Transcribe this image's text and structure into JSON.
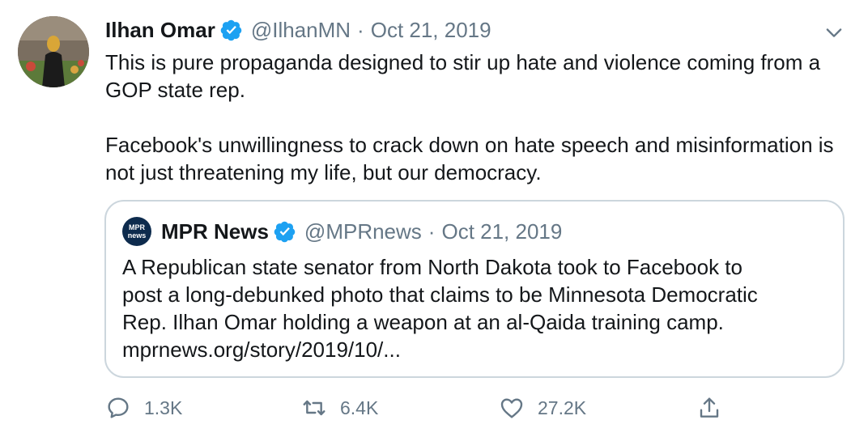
{
  "tweet": {
    "author_name": "Ilhan Omar",
    "handle": "@IlhanMN",
    "separator": "·",
    "date": "Oct 21, 2019",
    "text_paragraph_1": "This is pure propaganda designed to stir up hate and violence coming from a GOP state rep.",
    "text_paragraph_2": "Facebook's unwillingness to crack down on hate speech and misinformation is not just threatening my life, but our democracy."
  },
  "quoted": {
    "logo_line_1": "MPR",
    "logo_line_2": "news",
    "author_name": "MPR News",
    "handle": "@MPRnews",
    "separator": "·",
    "date": "Oct 21, 2019",
    "lines": [
      "A Republican state senator from North Dakota took to Facebook to",
      "post a long-debunked photo that claims to be Minnesota Democratic",
      "Rep. Ilhan Omar holding a weapon at an al-Qaida training camp.",
      "mprnews.org/story/2019/10/..."
    ]
  },
  "actions": {
    "reply_count": "1.3K",
    "retweet_count": "6.4K",
    "like_count": "27.2K"
  },
  "icons": {
    "verified": "verified-badge-icon",
    "menu": "chevron-down-icon",
    "reply": "reply-icon",
    "retweet": "retweet-icon",
    "like": "heart-icon",
    "share": "share-icon"
  },
  "colors": {
    "verified": "#1da1f2",
    "secondary_text": "#657786",
    "border": "#ccd6dd"
  }
}
